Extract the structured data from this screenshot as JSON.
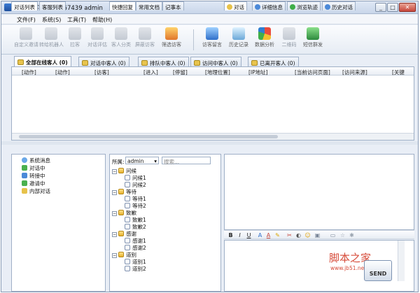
{
  "window": {
    "title": "网站多客宝  DKB167439  admin",
    "controls": [
      "_",
      "□",
      "✕"
    ]
  },
  "menu": [
    "文件(F)",
    "系统(S)",
    "工具(T)",
    "帮助(H)"
  ],
  "toolbar": [
    {
      "label": "自定义邀请",
      "enabled": false
    },
    {
      "label": "转给机器人",
      "enabled": false
    },
    {
      "label": "拉客",
      "enabled": false
    },
    {
      "label": "对话评估",
      "enabled": false
    },
    {
      "label": "客人分类",
      "enabled": false
    },
    {
      "label": "屏蔽访客",
      "enabled": false
    },
    {
      "label": "筛选访客",
      "enabled": true
    },
    {
      "label": "访客留言",
      "enabled": true
    },
    {
      "label": "历史记录",
      "enabled": true
    },
    {
      "label": "数据分析",
      "enabled": true
    },
    {
      "label": "二维码",
      "enabled": false
    },
    {
      "label": "短信群发",
      "enabled": true
    }
  ],
  "visitor_tabs": [
    "全部在线客人 (0)",
    "对话中客人 (0)",
    "排队中客人 (0)",
    "访问中客人 (0)",
    "已离开客人 (0)"
  ],
  "visitor_columns": [
    "[动作]",
    "[动作]",
    "[访客]",
    "[进入]",
    "[停留]",
    "[地理位置]",
    "[IP地址]",
    "[当前访问页面]",
    "[访问来源]",
    "[关键"
  ],
  "left_panel": {
    "tabs": [
      "对话列表",
      "客服列表"
    ],
    "items": [
      "系统消息",
      "对话中",
      "转接中",
      "邀请中",
      "内部对话"
    ]
  },
  "middle_panel": {
    "tabs": [
      "快捷回复",
      "常用文档",
      "记事本"
    ],
    "owner_label": "所属:",
    "owner_value": "admin",
    "search_placeholder": "搜索...",
    "groups": [
      {
        "name": "问候",
        "items": [
          "问候1",
          "问候2"
        ]
      },
      {
        "name": "等待",
        "items": [
          "等待1",
          "等待2"
        ]
      },
      {
        "name": "致歉",
        "items": [
          "致歉1",
          "致歉2"
        ]
      },
      {
        "name": "感谢",
        "items": [
          "感谢1",
          "感谢2"
        ]
      },
      {
        "name": "道别",
        "items": [
          "道别1",
          "道别2"
        ]
      }
    ]
  },
  "chat_panel": {
    "tabs": [
      "对话",
      "详细信息",
      "浏览轨迹",
      "历史对话"
    ],
    "format_buttons": [
      "B",
      "I",
      "U",
      "A",
      "A",
      "✎",
      "✂",
      "◐",
      "☺",
      "▣",
      "▭",
      "☆",
      "✱"
    ],
    "send_label": "SEND"
  },
  "watermark": {
    "title": "脚本之家",
    "url": "www.jb51.net"
  },
  "colors": {
    "accent": "#3a7bd5",
    "border": "#9fb0c7",
    "watermark": "#d64a38"
  }
}
